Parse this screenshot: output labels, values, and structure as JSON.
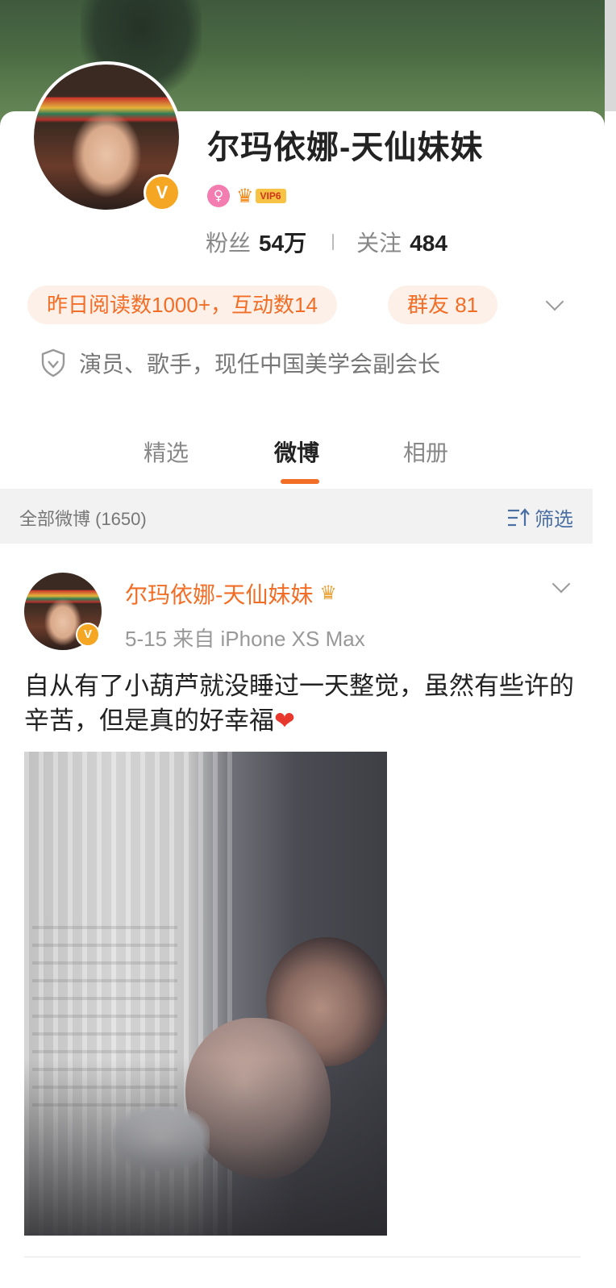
{
  "profile": {
    "name": "尔玛依娜-天仙妹妹",
    "verified_mark": "V",
    "gender_icon": "female-icon",
    "vip_label": "VIP6",
    "fans_label": "粉丝",
    "fans_value": "54万",
    "follow_label": "关注",
    "follow_value": "484",
    "reads_pill": "昨日阅读数1000+，互动数14",
    "group_pill": "群友 81",
    "bio": "演员、歌手，现任中国美学会副会长"
  },
  "tabs": [
    {
      "label": "精选",
      "active": false
    },
    {
      "label": "微博",
      "active": true
    },
    {
      "label": "相册",
      "active": false
    }
  ],
  "feed": {
    "count_label": "全部微博 (1650)",
    "filter_label": "筛选"
  },
  "post": {
    "author": "尔玛依娜-天仙妹妹",
    "meta": "5-15  来自 iPhone XS Max",
    "text": "自从有了小葫芦就没睡过一天整觉，虽然有些许的辛苦，但是真的好幸福",
    "emoji": "❤"
  },
  "colors": {
    "accent": "#f26d25",
    "verified": "#f5a623",
    "link": "#4a6fa5"
  }
}
